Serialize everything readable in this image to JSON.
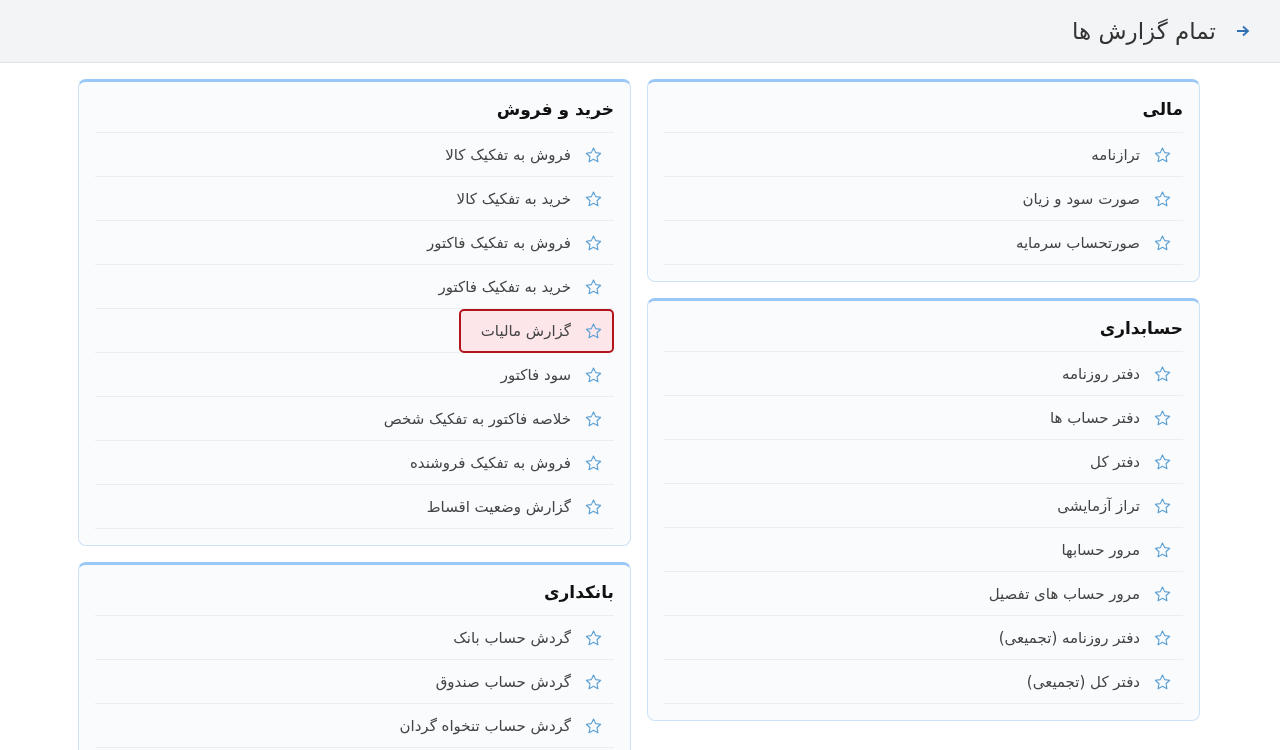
{
  "header": {
    "title": "تمام گزارش ها"
  },
  "columns": [
    {
      "cards": [
        {
          "title": "مالی",
          "items": [
            {
              "label": "ترازنامه",
              "highlighted": false
            },
            {
              "label": "صورت سود و زیان",
              "highlighted": false
            },
            {
              "label": "صورتحساب سرمایه",
              "highlighted": false
            }
          ]
        },
        {
          "title": "حسابداری",
          "items": [
            {
              "label": "دفتر روزنامه",
              "highlighted": false
            },
            {
              "label": "دفتر حساب ها",
              "highlighted": false
            },
            {
              "label": "دفتر کل",
              "highlighted": false
            },
            {
              "label": "تراز آزمایشی",
              "highlighted": false
            },
            {
              "label": "مرور حسابها",
              "highlighted": false
            },
            {
              "label": "مرور حساب های تفصیل",
              "highlighted": false
            },
            {
              "label": "دفتر روزنامه (تجمیعی)",
              "highlighted": false
            },
            {
              "label": "دفتر کل (تجمیعی)",
              "highlighted": false
            }
          ]
        }
      ]
    },
    {
      "cards": [
        {
          "title": "خرید و فروش",
          "items": [
            {
              "label": "فروش به تفکیک کالا",
              "highlighted": false
            },
            {
              "label": "خرید به تفکیک کالا",
              "highlighted": false
            },
            {
              "label": "فروش به تفکیک فاکتور",
              "highlighted": false
            },
            {
              "label": "خرید به تفکیک فاکتور",
              "highlighted": false
            },
            {
              "label": "گزارش مالیات",
              "highlighted": true
            },
            {
              "label": "سود فاکتور",
              "highlighted": false
            },
            {
              "label": "خلاصه فاکتور به تفکیک شخص",
              "highlighted": false
            },
            {
              "label": "فروش به تفکیک فروشنده",
              "highlighted": false
            },
            {
              "label": "گزارش وضعیت اقساط",
              "highlighted": false
            }
          ]
        },
        {
          "title": "بانکداری",
          "items": [
            {
              "label": "گردش حساب بانک",
              "highlighted": false
            },
            {
              "label": "گردش حساب صندوق",
              "highlighted": false
            },
            {
              "label": "گردش حساب تنخواه گردان",
              "highlighted": false
            }
          ]
        }
      ]
    }
  ]
}
